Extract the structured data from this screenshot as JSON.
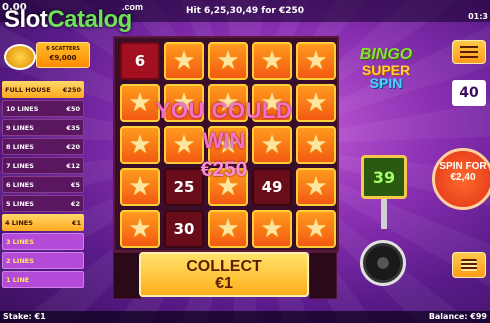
{
  "header": {
    "balance_left": "0.00",
    "hit_info": "Hit 6,25,30,49 for €250",
    "clock": "01:3"
  },
  "watermark": {
    "part1": "Slot",
    "part2": "Catalog",
    "suffix": ".com"
  },
  "scatter_box": {
    "label": "6 SCATTERS",
    "value": "€9,000"
  },
  "paytable": [
    {
      "label": "FULL HOUSE",
      "value": "€250",
      "style": "fh"
    },
    {
      "label": "10 LINES",
      "value": "€50",
      "style": "hi"
    },
    {
      "label": "9 LINES",
      "value": "€35",
      "style": "hi"
    },
    {
      "label": "8 LINES",
      "value": "€20",
      "style": "hi"
    },
    {
      "label": "7 LINES",
      "value": "€12",
      "style": "hi"
    },
    {
      "label": "6 LINES",
      "value": "€5",
      "style": "hi"
    },
    {
      "label": "5 LINES",
      "value": "€2",
      "style": "hi"
    },
    {
      "label": "4 LINES",
      "value": "€1",
      "style": "sel"
    },
    {
      "label": "3 LINES",
      "value": "",
      "style": "lo"
    },
    {
      "label": "2 LINES",
      "value": "",
      "style": "lo"
    },
    {
      "label": "1 LINE",
      "value": "",
      "style": "lo"
    }
  ],
  "grid": [
    [
      "6",
      "star",
      "star",
      "star",
      "star"
    ],
    [
      "star",
      "star",
      "star",
      "star",
      "star"
    ],
    [
      "star",
      "star",
      "star",
      "star",
      "star"
    ],
    [
      "star",
      "25",
      "star",
      "49",
      "star"
    ],
    [
      "star",
      "30",
      "star",
      "star",
      "star"
    ]
  ],
  "overlay": {
    "line1": "YOU COULD",
    "line2": "WIN",
    "line3": "€250"
  },
  "collect": {
    "label": "COLLECT",
    "value": "€1"
  },
  "logo": {
    "line1": "BINGO",
    "line2": "SUPER",
    "line3": "SPIN"
  },
  "lines_count": "40",
  "ball": "39",
  "spin_button": {
    "label": "SPIN FOR",
    "value": "€2,40"
  },
  "footer": {
    "stake": "Stake: €1",
    "balance": "Balance: €99"
  },
  "icons": {
    "menu": "hamburger-menu-icon",
    "stake": "coin-stack-icon",
    "record": "vinyl-record-icon",
    "star": "star-icon"
  },
  "colors": {
    "tile": "#ff9a1e",
    "tile_border": "#ffcf3a",
    "dark_tile": "#a31021",
    "accent": "#ffae1a",
    "background": "#8a2fb3"
  }
}
